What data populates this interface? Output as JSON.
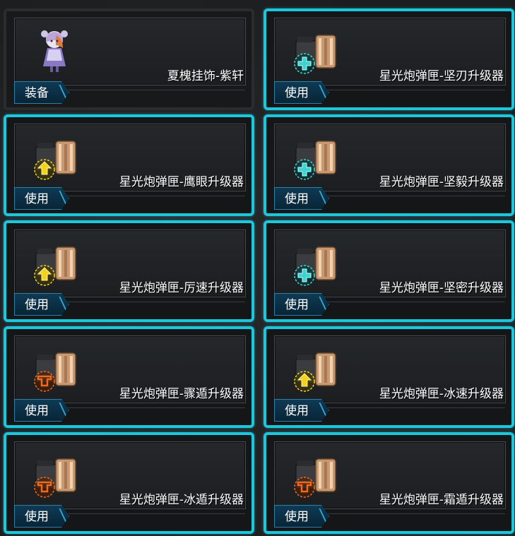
{
  "items": [
    {
      "name": "夏槐挂饰-紫轩",
      "button": "装备",
      "icon": "doll-figure-icon",
      "selected": false
    },
    {
      "name": "星光炮弹匣-坚刃升级器",
      "button": "使用",
      "icon": "cannon-magazine-cross-teal-icon",
      "selected": true
    },
    {
      "name": "星光炮弹匣-鹰眼升级器",
      "button": "使用",
      "icon": "cannon-magazine-arrow-yellow-icon",
      "selected": true
    },
    {
      "name": "星光炮弹匣-坚毅升级器",
      "button": "使用",
      "icon": "cannon-magazine-cross-teal-icon",
      "selected": true
    },
    {
      "name": "星光炮弹匣-厉速升级器",
      "button": "使用",
      "icon": "cannon-magazine-arrow-yellow-icon",
      "selected": true
    },
    {
      "name": "星光炮弹匣-坚密升级器",
      "button": "使用",
      "icon": "cannon-magazine-cross-teal-icon",
      "selected": true
    },
    {
      "name": "星光炮弹匣-骤遁升级器",
      "button": "使用",
      "icon": "cannon-magazine-shield-orange-icon",
      "selected": true
    },
    {
      "name": "星光炮弹匣-冰速升级器",
      "button": "使用",
      "icon": "cannon-magazine-arrow-yellow-icon",
      "selected": true
    },
    {
      "name": "星光炮弹匣-冰遁升级器",
      "button": "使用",
      "icon": "cannon-magazine-shield-orange-icon",
      "selected": true
    },
    {
      "name": "星光炮弹匣-霜遁升级器",
      "button": "使用",
      "icon": "cannon-magazine-shield-orange-icon",
      "selected": true
    }
  ],
  "colors": {
    "highlight": "#1cc7dc",
    "button": "#0e3a55",
    "yellow": "#f5d21a",
    "teal": "#3fd3d0",
    "orange": "#f06a1e"
  }
}
